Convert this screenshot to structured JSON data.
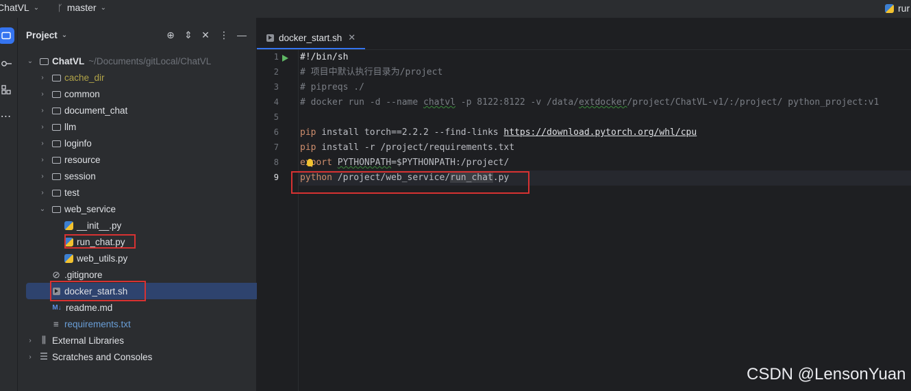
{
  "topbar": {
    "project_name": "ChatVL",
    "branch": "master",
    "run_label": "rur"
  },
  "project_panel": {
    "title": "Project",
    "root": {
      "name": "ChatVL",
      "path": "~/Documents/gitLocal/ChatVL"
    },
    "folders": [
      "cache_dir",
      "common",
      "document_chat",
      "llm",
      "loginfo",
      "resource",
      "session",
      "test",
      "web_service"
    ],
    "web_service_files": [
      "__init__.py",
      "run_chat.py",
      "web_utils.py"
    ],
    "root_files": [
      ".gitignore",
      "docker_start.sh",
      "readme.md",
      "requirements.txt"
    ],
    "external_libraries": "External Libraries",
    "scratches": "Scratches and Consoles"
  },
  "editor": {
    "tab": "docker_start.sh",
    "line_numbers": [
      "1",
      "2",
      "3",
      "4",
      "5",
      "6",
      "7",
      "8",
      "9"
    ],
    "lines": {
      "l1": "#!/bin/sh",
      "l2": "# 项目中默认执行目录为/project",
      "l3": "# pipreqs ./",
      "l4a": "# docker run -d --name ",
      "l4b": "chatvl",
      "l4c": " -p 8122:8122 -v /data/",
      "l4d": "extdocker",
      "l4e": "/project/ChatVL-v1/:/project/ python_project:v1",
      "l6a": "pip",
      "l6b": " install torch==2.2.2 --find-links ",
      "l6c": "https://download.pytorch.org/whl/cpu",
      "l7a": "pip",
      "l7b": " install -r /project/requirements.txt",
      "l8a": "export",
      "l8b": "PYTHONPATH",
      "l8c": "=$PYTHONPATH:/project/",
      "l9a": "python",
      "l9b": " /project/web_service/",
      "l9c": "run_chat",
      "l9d": ".py"
    }
  },
  "watermark": "CSDN @LensonYuan"
}
